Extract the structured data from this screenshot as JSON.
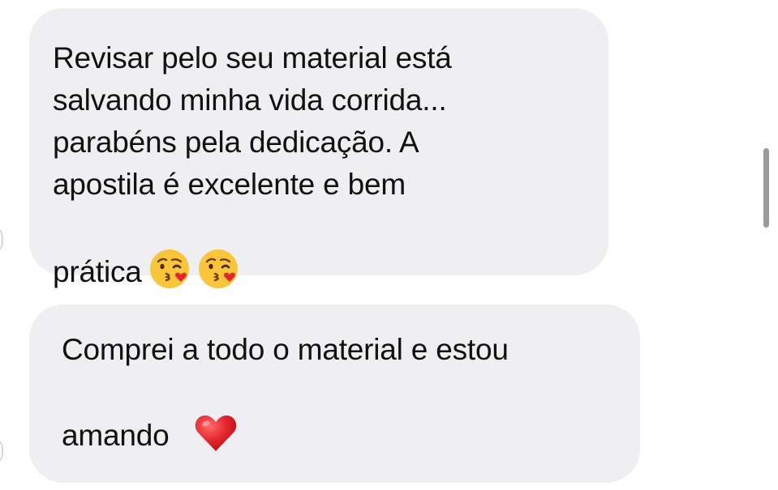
{
  "chat": {
    "messages": [
      {
        "text": "Revisar pelo seu material está\nsalvando minha vida corrida...\nparabéns pela dedicação. A\napostila é excelente e bem\nprática",
        "emojis": [
          "kissing-face-with-heart-icon",
          "kissing-face-with-heart-icon"
        ]
      },
      {
        "text": "Comprei a todo o material e estou\namando",
        "emojis": [
          "red-heart-icon"
        ]
      }
    ]
  },
  "colors": {
    "bubble": "#efeff1",
    "text": "#111111",
    "scrollbar": "#9b9b9f",
    "emoji_face": "#f9c53a",
    "heart": "#e2262d"
  }
}
